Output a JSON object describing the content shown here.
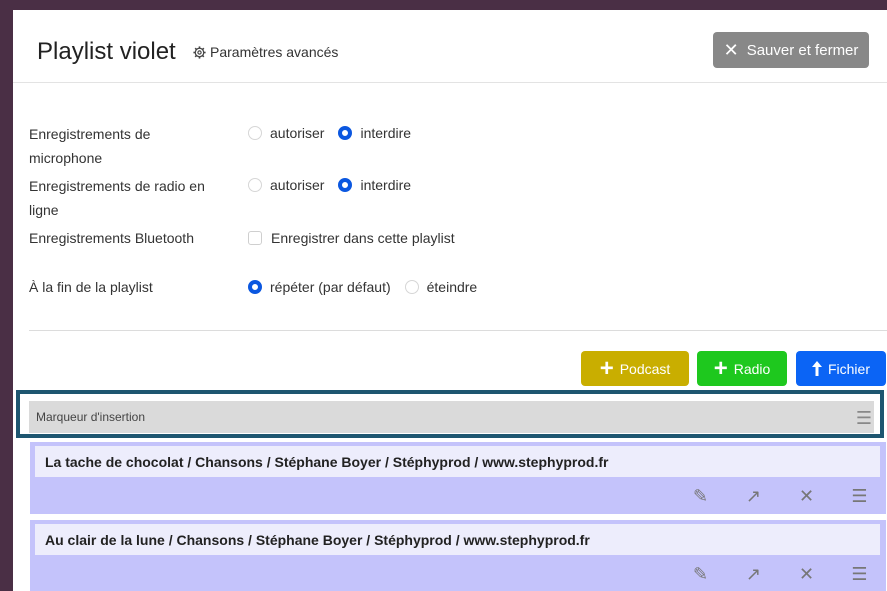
{
  "header": {
    "title": "Playlist violet",
    "advanced_label": "Paramètres avancés",
    "save_label": "Sauver et fermer"
  },
  "settings": {
    "microphone": {
      "label_line1": "Enregistrements de",
      "label_line2": "microphone",
      "opt1": "autoriser",
      "opt2": "interdire",
      "selected": "interdire"
    },
    "radio": {
      "label_line1": "Enregistrements de radio en",
      "label_line2": "ligne",
      "opt1": "autoriser",
      "opt2": "interdire",
      "selected": "interdire"
    },
    "bluetooth": {
      "label": "Enregistrements Bluetooth",
      "checkbox_label": "Enregistrer dans cette playlist",
      "checked": false
    },
    "end_of_playlist": {
      "label": "À la fin de la playlist",
      "opt1": "répéter (par défaut)",
      "opt2": "éteindre",
      "selected": "répéter (par défaut)"
    }
  },
  "add_buttons": {
    "podcast": "Podcast",
    "radio": "Radio",
    "file": "Fichier"
  },
  "insertion_marker": {
    "label": "Marqueur d'insertion"
  },
  "tracks": [
    {
      "title": "La tache de chocolat / Chansons / Stéphane Boyer / Stéphyprod / www.stephyprod.fr"
    },
    {
      "title": "Au clair de la lune / Chansons / Stéphane Boyer / Stéphyprod / www.stephyprod.fr"
    }
  ],
  "colors": {
    "podcast": "#c9ae00",
    "radio": "#1ec81e",
    "file": "#0b64f5",
    "track_bg": "#c4c3fb",
    "marker_border": "#1e5670"
  },
  "icons": {
    "advanced": "gear-icon",
    "save": "close-icon",
    "add": "plus-icon",
    "file": "arrow-up-icon",
    "edit": "pencil-icon",
    "open": "arrow-up-right-icon",
    "delete": "close-icon",
    "drag": "menu-icon"
  }
}
